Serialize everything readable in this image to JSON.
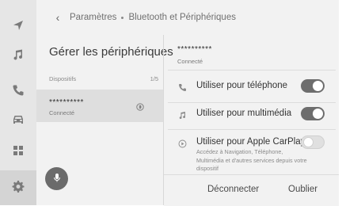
{
  "header": {
    "back_icon": "chevron-left-icon",
    "breadcrumb": [
      "Paramètres",
      "Bluetooth et Périphériques"
    ]
  },
  "rail": {
    "items": [
      {
        "icon": "navigation-arrow-icon"
      },
      {
        "icon": "music-note-icon"
      },
      {
        "icon": "phone-icon"
      },
      {
        "icon": "car-icon"
      },
      {
        "icon": "apps-grid-icon"
      },
      {
        "icon": "settings-gear-icon",
        "active": true
      }
    ]
  },
  "left_pane": {
    "title": "Gérer les périphériques",
    "list_label": "Dispositifs",
    "list_count": "1/5",
    "devices": [
      {
        "name": "**********",
        "status": "Connecté",
        "icon": "bluetooth-icon"
      }
    ],
    "mic_icon": "microphone-icon"
  },
  "right_pane": {
    "device_name": "**********",
    "device_status": "Connecté",
    "options": [
      {
        "label": "Utiliser pour téléphone",
        "icon": "phone-icon",
        "enabled": true
      },
      {
        "label": "Utiliser pour multimédia",
        "icon": "music-note-icon",
        "enabled": true
      },
      {
        "label": "Utiliser pour Apple CarPlay",
        "icon": "carplay-icon",
        "enabled": false,
        "description": "Accédez à Navigation, Téléphone, Multimédia et d'autres services depuis votre dispositif"
      }
    ],
    "actions": {
      "disconnect": "Déconnecter",
      "forget": "Oublier"
    }
  },
  "colors": {
    "toggle_on": "#6d6d6d",
    "toggle_off": "#e0e0e0",
    "background": "#f2f2f2"
  }
}
